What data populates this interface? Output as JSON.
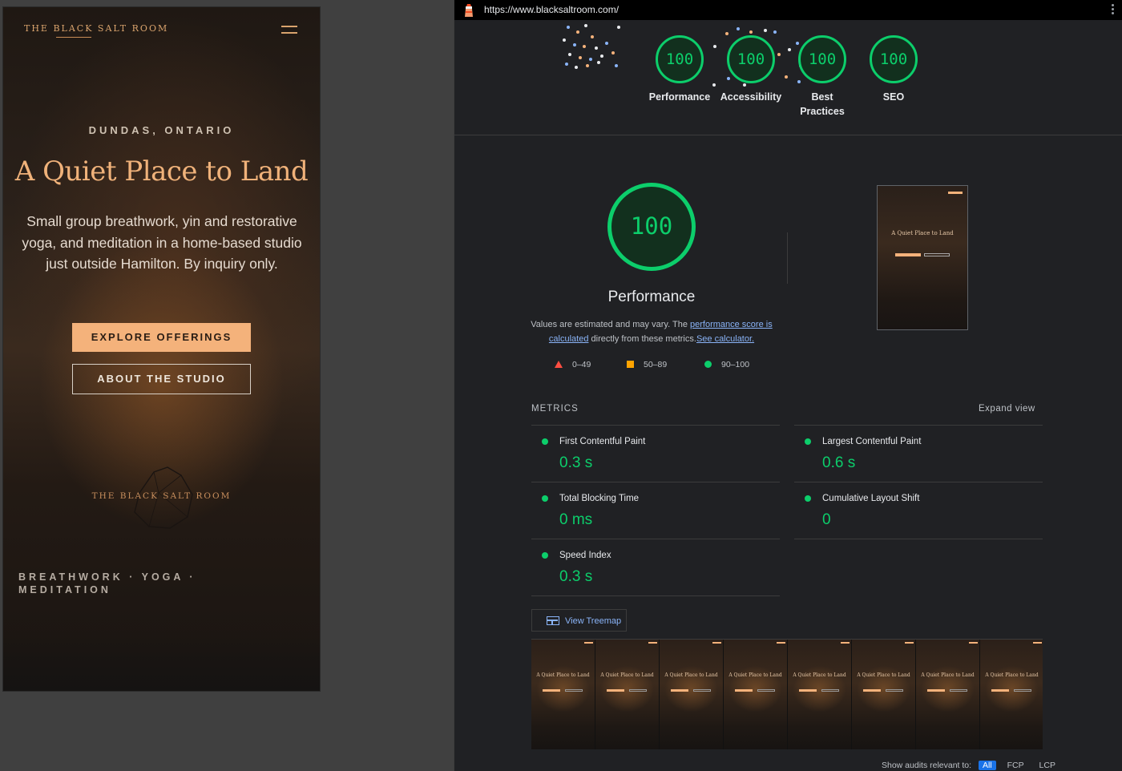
{
  "site": {
    "logo": "THE BLACK SALT ROOM",
    "kicker": "DUNDAS, ONTARIO",
    "title": "A Quiet Place to Land",
    "subtitle": "Small group breathwork, yin and restorative yoga, and meditation in a home-based studio just outside Hamilton. By inquiry only.",
    "primary_cta": "EXPLORE OFFERINGS",
    "secondary_cta": "ABOUT THE STUDIO",
    "mid_logo": "THE BLACK SALT ROOM",
    "pillars": "BREATHWORK · YOGA · MEDITATION"
  },
  "lighthouse": {
    "url": "https://www.blacksaltroom.com/",
    "categories": [
      {
        "label": "Performance",
        "score": "100"
      },
      {
        "label": "Accessibility",
        "score": "100"
      },
      {
        "label": "Best Practices",
        "score": "100"
      },
      {
        "label": "SEO",
        "score": "100"
      }
    ],
    "performance": {
      "score": "100",
      "title": "Performance",
      "note_pre": "Values are estimated and may vary. The ",
      "note_link1": "performance score is calculated",
      "note_mid": " directly from these metrics.",
      "note_link2": "See calculator.",
      "screenshot_title": "A Quiet Place to Land"
    },
    "legend": {
      "fail": "0–49",
      "average": "50–89",
      "pass": "90–100"
    },
    "metrics_header": "METRICS",
    "expand_view": "Expand view",
    "metrics": [
      {
        "name": "First Contentful Paint",
        "value": "0.3 s"
      },
      {
        "name": "Largest Contentful Paint",
        "value": "0.6 s"
      },
      {
        "name": "Total Blocking Time",
        "value": "0 ms"
      },
      {
        "name": "Cumulative Layout Shift",
        "value": "0"
      },
      {
        "name": "Speed Index",
        "value": "0.3 s"
      }
    ],
    "view_treemap": "View Treemap",
    "filmstrip_frame_title": "A Quiet Place to Land",
    "audit_filter": {
      "label": "Show audits relevant to:",
      "options": [
        "All",
        "FCP",
        "LCP"
      ]
    },
    "colors": {
      "pass": "#0cce6b",
      "average": "#ffa400",
      "fail": "#ff4e42",
      "link": "#8ab4f8"
    }
  }
}
